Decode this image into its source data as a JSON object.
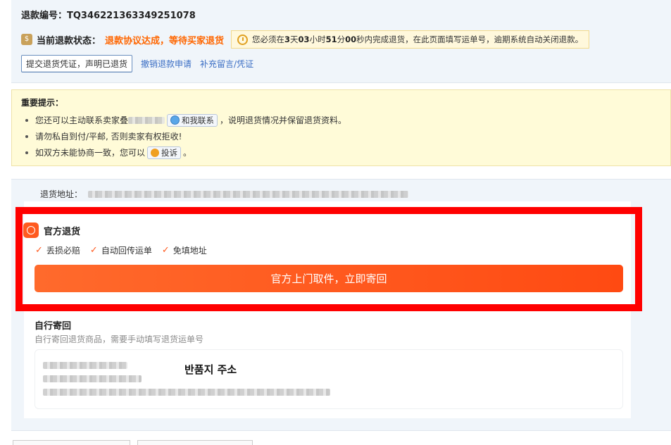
{
  "refund": {
    "no_label": "退款编号：",
    "no_value": "TQ346221363349251078",
    "status_label": "当前退款状态：",
    "status_value": "退款协议达成，等待买家退货",
    "timer_prefix": "您必须在",
    "timer_days": "3",
    "timer_days_unit": "天",
    "timer_hours": "03",
    "timer_hours_unit": "小时",
    "timer_minutes": "51",
    "timer_minutes_unit": "分",
    "timer_seconds": "00",
    "timer_suffix": "秒内完成退货，在此页面填写运单号，逾期系统自动关闭退款。",
    "btn_submit_proof": "提交退货凭证，声明已退货",
    "link_cancel": "撤销退款申请",
    "link_supplement": "补充留言/凭证"
  },
  "notice": {
    "title": "重要提示：",
    "item1_pre": "您还可以主动联系卖家",
    "item1_seller_prefix": "叠",
    "contact_btn": "和我联系",
    "item1_post": "，说明退货情况并保留退货资料。",
    "item2": "请勿私自到付/平邮, 否则卖家有权拒收!",
    "item3_pre": "如双方未能协商一致，您可以",
    "complain_btn": "投诉",
    "item3_post": "。"
  },
  "return_panel": {
    "address_label": "退货地址：",
    "official_title": "官方退货",
    "features": [
      "丢损必赔",
      "自动回传运单",
      "免填地址"
    ],
    "cta_label": "官方上门取件，立即寄回",
    "self_title": "自行寄回",
    "self_desc": "自行寄回退货商品，需要手动填写退货运单号",
    "card_overlay": "반품지 주소"
  },
  "colors": {
    "accent": "#ff5a1f",
    "status": "#ff6600",
    "link": "#3b6ec4",
    "highlight_frame": "#ff0000"
  }
}
